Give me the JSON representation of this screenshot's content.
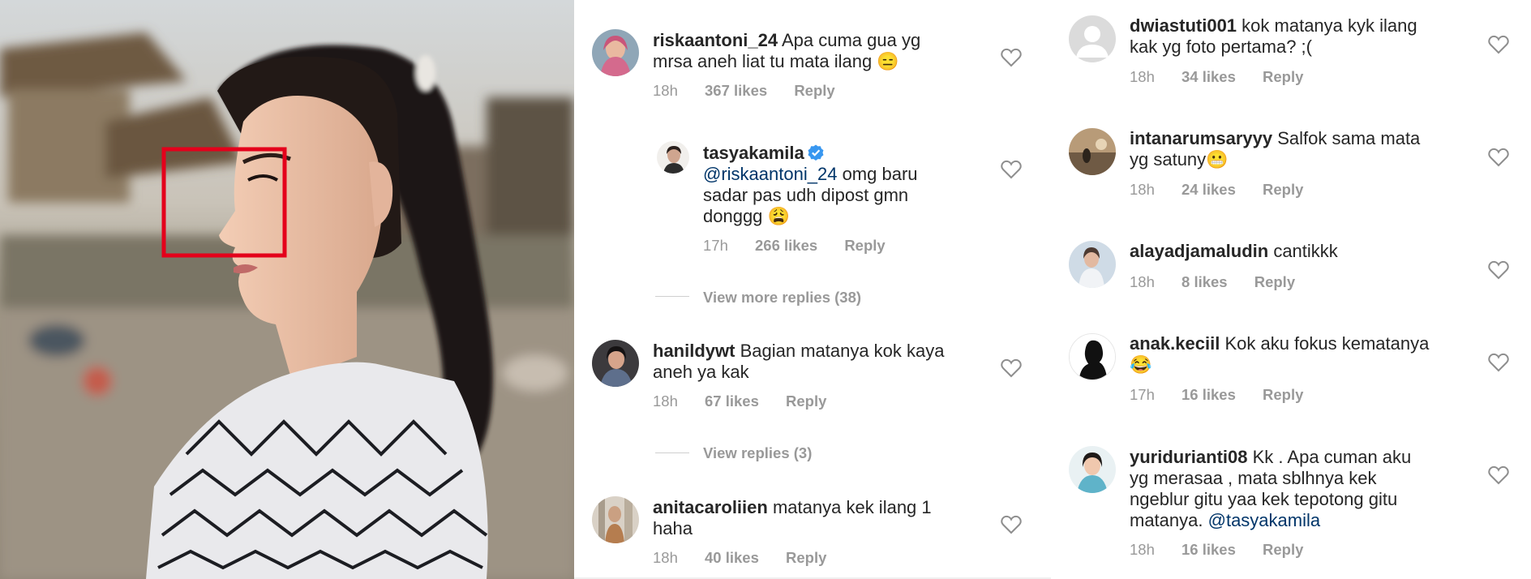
{
  "colors": {
    "text": "#262626",
    "meta": "#999999",
    "mention": "#003569",
    "verified": "#3897f0",
    "highlight": "#e4001b"
  },
  "photo": {
    "icon": "photo-of-woman-profile",
    "highlight_box": "red-rectangle-around-eye"
  },
  "comments_mid": [
    {
      "username": "riskaantoni_24",
      "line1": "Apa cuma gua yg",
      "line2": "mrsa aneh liat tu mata ilang 😑",
      "time": "18h",
      "likes": "367 likes",
      "reply": "Reply"
    },
    {
      "username": "tasyakamila",
      "mention": "@riskaantoni_24",
      "line1": "omg baru",
      "line2": "sadar pas udh dipost gmn",
      "line3": "donggg 😩",
      "time": "17h",
      "likes": "266 likes",
      "reply": "Reply"
    },
    {
      "username": "hanildywt",
      "line1": "Bagian matanya kok kaya",
      "line2": "aneh ya kak",
      "time": "18h",
      "likes": "67 likes",
      "reply": "Reply"
    },
    {
      "username": "anitacaroliien",
      "line1": "matanya kek ilang 1",
      "line2": "haha",
      "time": "18h",
      "likes": "40 likes",
      "reply": "Reply"
    }
  ],
  "view_more_replies": "View more replies (38)",
  "view_replies": "View replies (3)",
  "comments_right": [
    {
      "username": "dwiastuti001",
      "line1": "kok matanya kyk ilang",
      "line2": "kak yg foto pertama? ;(",
      "time": "18h",
      "likes": "34 likes",
      "reply": "Reply"
    },
    {
      "username": "intanarumsaryyy",
      "line1": "Salfok sama mata",
      "line2": "yg satuny😬",
      "time": "18h",
      "likes": "24 likes",
      "reply": "Reply"
    },
    {
      "username": "alayadjamaludin",
      "line1": "cantikkk",
      "time": "18h",
      "likes": "8 likes",
      "reply": "Reply"
    },
    {
      "username": "anak.keciil",
      "line1": "Kok aku fokus kematanya",
      "line2": "😂",
      "time": "17h",
      "likes": "16 likes",
      "reply": "Reply"
    },
    {
      "username": "yuridurianti08",
      "line1": "Kk . Apa cuman aku",
      "line2": "yg merasaa , mata sblhnya kek",
      "line3": "ngeblur gitu yaa kek tepotong gitu",
      "line4": "matanya.",
      "mention": "@tasyakamila",
      "time": "18h",
      "likes": "16 likes",
      "reply": "Reply"
    }
  ]
}
